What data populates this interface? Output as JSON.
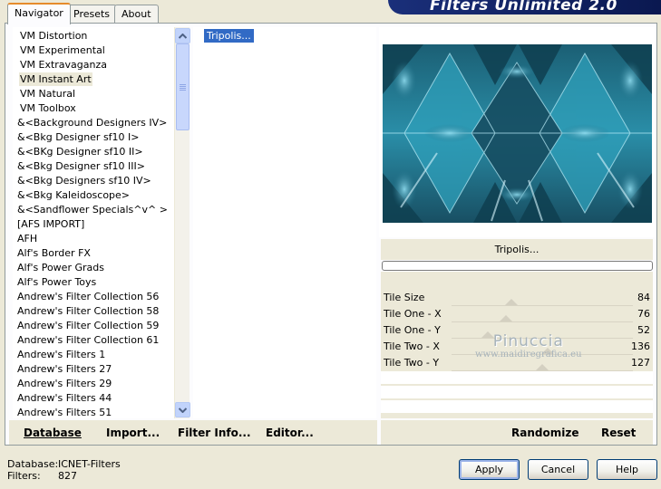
{
  "tabs": [
    {
      "label": "Navigator",
      "active": true
    },
    {
      "label": "Presets",
      "active": false
    },
    {
      "label": "About",
      "active": false
    }
  ],
  "banner_title": "Filters Unlimited 2.0",
  "categories": [
    "VM Distortion",
    "VM Experimental",
    "VM Extravaganza",
    "VM Instant Art",
    "VM Natural",
    "VM Toolbox",
    "&<Background Designers IV>",
    "&<Bkg Designer sf10 I>",
    "&<BKg Designer sf10 II>",
    "&<Bkg Designer sf10 III>",
    "&<Bkg Designers sf10 IV>",
    "&<Bkg Kaleidoscope>",
    "&<Sandflower Specials^v^ >",
    "[AFS IMPORT]",
    "AFH",
    "Alf's Border FX",
    "Alf's Power Grads",
    "Alf's Power Toys",
    "Andrew's Filter Collection 56",
    "Andrew's Filter Collection 58",
    "Andrew's Filter Collection 59",
    "Andrew's Filter Collection 61",
    "Andrew's Filters 1",
    "Andrew's Filters 27",
    "Andrew's Filters 29",
    "Andrew's Filters 44",
    "Andrew's Filters 51"
  ],
  "selected_category": "VM Instant Art",
  "filters": [
    "Tripolis..."
  ],
  "selected_filter": "Tripolis...",
  "preview_filter_name": "Tripolis...",
  "progress": 0,
  "params": [
    {
      "name": "Tile Size",
      "value": "84",
      "level": 0.33
    },
    {
      "name": "Tile One - X",
      "value": "76",
      "level": 0.3
    },
    {
      "name": "Tile One - Y",
      "value": "52",
      "level": 0.2
    },
    {
      "name": "Tile Two - X",
      "value": "136",
      "level": 0.53
    },
    {
      "name": "Tile Two - Y",
      "value": "127",
      "level": 0.5
    }
  ],
  "watermark": {
    "line1": "Pinuccia",
    "line2": "www.maidiregrafica.eu"
  },
  "toolbar": {
    "database": "Database",
    "import": "Import...",
    "filter_info": "Filter Info...",
    "editor": "Editor...",
    "randomize": "Randomize",
    "reset": "Reset"
  },
  "status": {
    "database_label": "Database:",
    "database_value": "ICNET-Filters",
    "filters_label": "Filters:",
    "filters_value": "827"
  },
  "buttons": {
    "apply": "Apply",
    "cancel": "Cancel",
    "help": "Help"
  },
  "colors": {
    "selection": "#316ac5",
    "accent_tab": "#e68b2c",
    "banner": "#1a2f7a"
  }
}
